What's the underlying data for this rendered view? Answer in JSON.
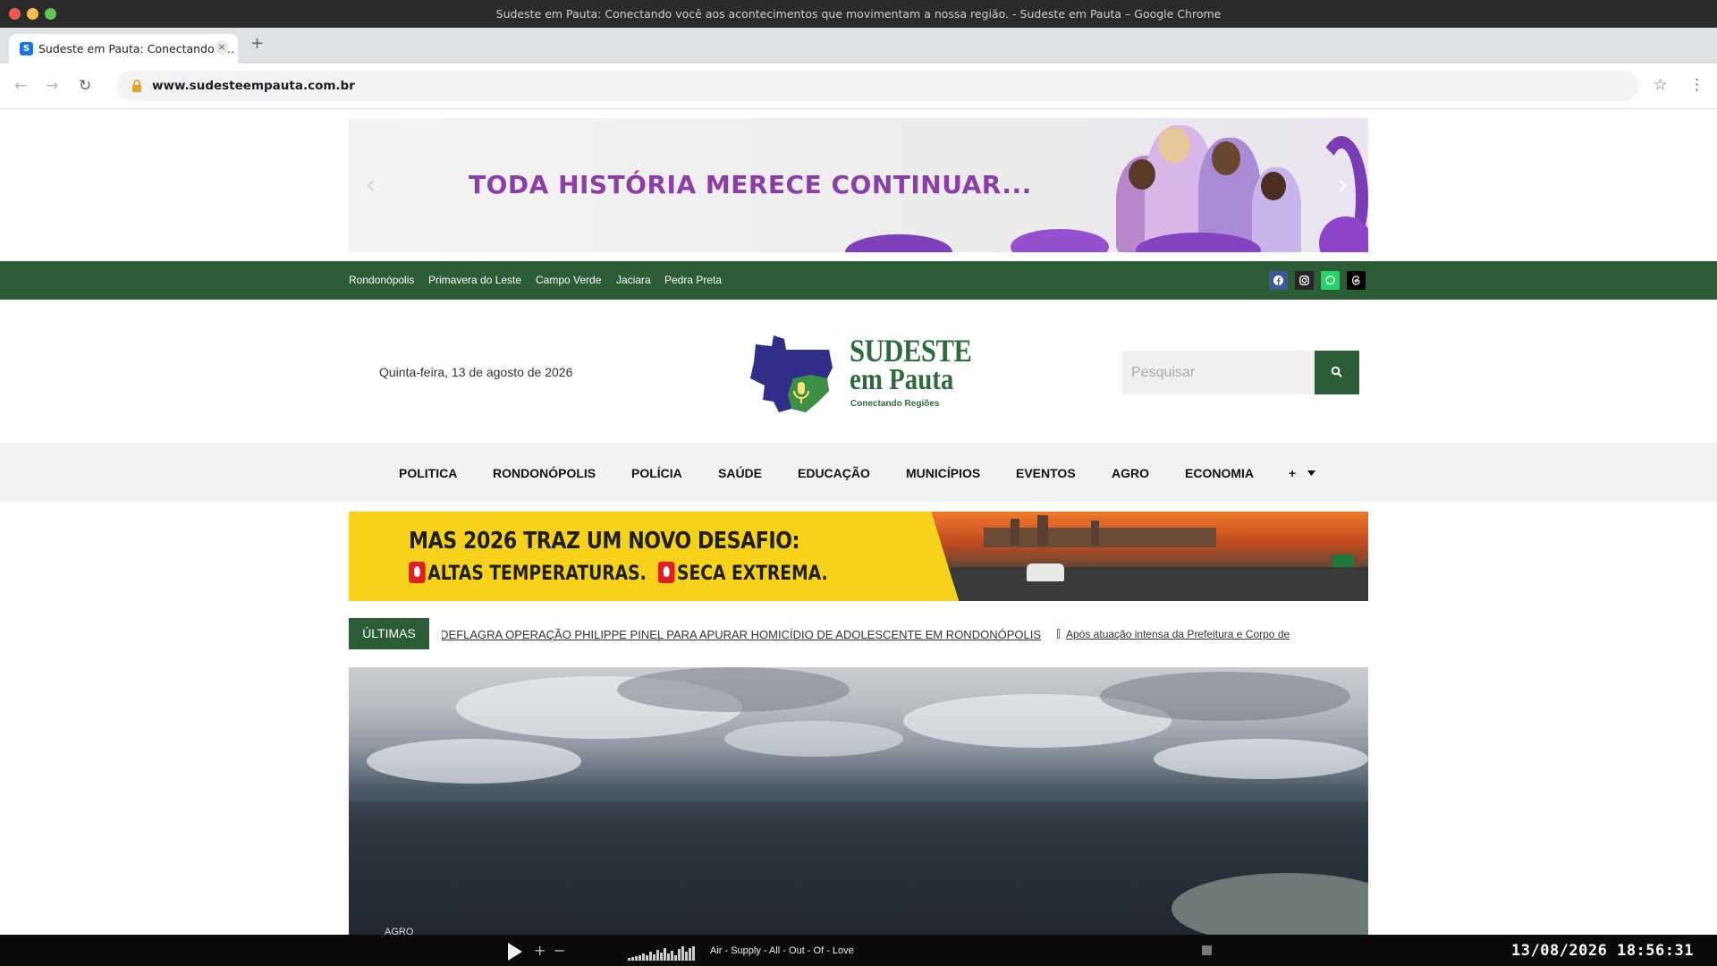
{
  "window": {
    "title": "Sudeste em Pauta: Conectando você aos acontecimentos que movimentam a nossa região. - Sudeste em Pauta – Google Chrome",
    "tab_title": "Sudeste em Pauta: Conectando v...",
    "favicon_letter": "S",
    "url": "www.sudesteempauta.com.br"
  },
  "banner": {
    "headline": "TODA HISTÓRIA MERECE CONTINUAR..."
  },
  "topbar": {
    "cities": [
      "Rondonópolis",
      "Primavera do Leste",
      "Campo Verde",
      "Jaciara",
      "Pedra Preta"
    ],
    "social_icons": [
      "facebook-icon",
      "instagram-icon",
      "whatsapp-icon",
      "threads-icon"
    ],
    "colors": {
      "bar": "#2b5d36",
      "facebook": "#3b5998",
      "instagram": "#262626",
      "whatsapp": "#25d366",
      "threads": "#000000"
    }
  },
  "header": {
    "date": "Quinta-feira, 13 de agosto de 2026",
    "logo_line1": "SUDESTE",
    "logo_line2": "em Pauta",
    "logo_tagline": "Conectando Regiões",
    "search_placeholder": "Pesquisar"
  },
  "nav": {
    "items": [
      "POLITICA",
      "RONDONÓPOLIS",
      "POLÍCIA",
      "SAÚDE",
      "EDUCAÇÃO",
      "MUNICÍPIOS",
      "EVENTOS",
      "AGRO",
      "ECONOMIA"
    ],
    "more": "+"
  },
  "ad": {
    "line1": "MAS 2026 TRAZ UM NOVO DESAFIO:",
    "line2a": "ALTAS TEMPERATURAS.",
    "line2b": "SECA EXTREMA."
  },
  "ticker": {
    "label": "ÚLTIMAS",
    "item1": "DEFLAGRA OPERAÇÃO PHILIPPE PINEL PARA APURAR HOMICÍDIO DE ADOLESCENTE EM RONDONÓPOLIS",
    "item2": "Após atuação intensa da Prefeitura e Corpo de"
  },
  "hero": {
    "tag": "AGRO"
  },
  "panel": {
    "song": "Air - Supply - All - Out - Of - Love",
    "clock": "13/08/2026 18:56:31"
  }
}
